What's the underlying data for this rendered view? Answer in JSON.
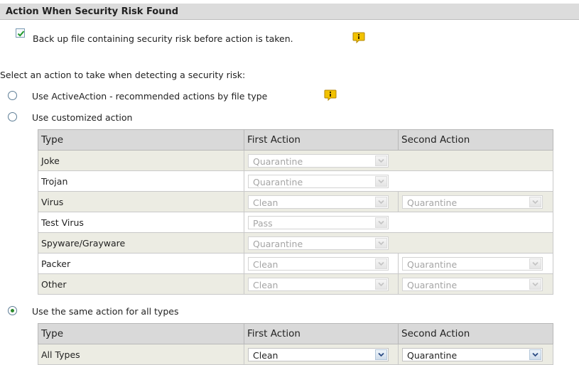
{
  "section": {
    "title": "Action When Security Risk Found"
  },
  "backup": {
    "checked": true,
    "label": "Back up file containing security risk before action is taken."
  },
  "prompt": "Select an action to take when detecting a security risk:",
  "options": {
    "active_action": {
      "label": "Use ActiveAction - recommended actions by file type",
      "selected": false
    },
    "customized": {
      "label": "Use customized action",
      "selected": false
    },
    "same_action": {
      "label": "Use the same action for all types",
      "selected": true
    }
  },
  "custom_table": {
    "headers": [
      "Type",
      "First Action",
      "Second Action"
    ],
    "rows": [
      {
        "type": "Joke",
        "first": "Quarantine",
        "second": ""
      },
      {
        "type": "Trojan",
        "first": "Quarantine",
        "second": ""
      },
      {
        "type": "Virus",
        "first": "Clean",
        "second": "Quarantine"
      },
      {
        "type": "Test Virus",
        "first": "Pass",
        "second": ""
      },
      {
        "type": "Spyware/Grayware",
        "first": "Quarantine",
        "second": ""
      },
      {
        "type": "Packer",
        "first": "Clean",
        "second": "Quarantine"
      },
      {
        "type": "Other",
        "first": "Clean",
        "second": "Quarantine"
      }
    ]
  },
  "same_table": {
    "headers": [
      "Type",
      "First Action",
      "Second Action"
    ],
    "row": {
      "type": "All Types",
      "first": "Clean",
      "second": "Quarantine"
    }
  },
  "colors": {
    "header_bg": "#dcdcdc",
    "row_alt_bg": "#ecece3",
    "radio_selected": "#2b8a2b",
    "info_icon": "#f2c200"
  },
  "icons": {
    "checkbox_check": "check-icon",
    "info": "info-icon",
    "dropdown": "chevron-down-icon"
  }
}
